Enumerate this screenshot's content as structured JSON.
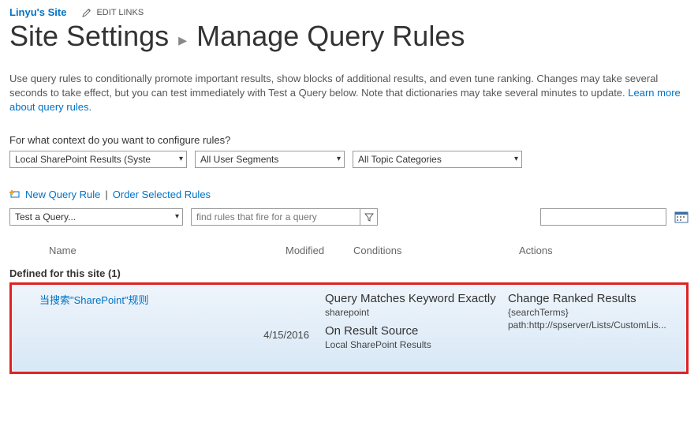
{
  "topbar": {
    "site_link": "Linyu's Site",
    "edit_links": "EDIT LINKS"
  },
  "title": {
    "primary": "Site Settings",
    "secondary": "Manage Query Rules"
  },
  "description": "Use query rules to conditionally promote important results, show blocks of additional results, and even tune ranking. Changes may take several seconds to take effect, but you can test immediately with Test a Query below. Note that dictionaries may take several minutes to update.",
  "learn_more": "Learn more about query rules.",
  "context_label": "For what context do you want to configure rules?",
  "selects": {
    "source": "Local SharePoint Results (Syste",
    "segment": "All User Segments",
    "topic": "All Topic Categories"
  },
  "action_links": {
    "new_rule": "New Query Rule",
    "order_rules": "Order Selected Rules"
  },
  "test_query_select": "Test a Query...",
  "query_placeholder": "find rules that fire for a query",
  "table": {
    "col_name": "Name",
    "col_modified": "Modified",
    "col_conditions": "Conditions",
    "col_actions": "Actions"
  },
  "group_header": "Defined for this site (1)",
  "rule": {
    "name": "当搜索\"SharePoint\"规则",
    "modified": "4/15/2016",
    "cond1_title": "Query Matches Keyword Exactly",
    "cond1_sub": "sharepoint",
    "cond2_title": "On Result Source",
    "cond2_sub": "Local SharePoint Results",
    "act_title": "Change Ranked Results",
    "act_sub1": "{searchTerms}",
    "act_sub2": "path:http://spserver/Lists/CustomLis..."
  }
}
